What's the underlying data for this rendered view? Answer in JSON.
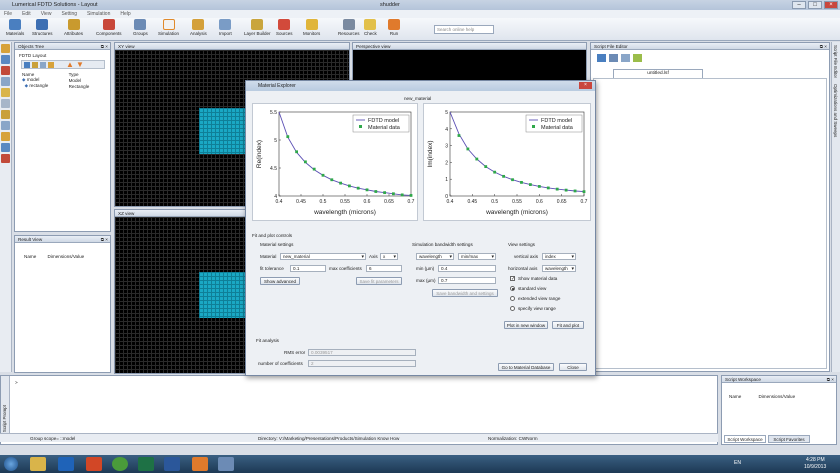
{
  "app": {
    "title": "Lumerical FDTD Solutions - Layout",
    "center_title": "shudder"
  },
  "menu": [
    "File",
    "Edit",
    "View",
    "Setting",
    "Simulation",
    "Help"
  ],
  "ribbon": [
    "Materials",
    "Structures",
    "Attributes",
    "Components",
    "Groups",
    "Simulation",
    "Analysis",
    "Import",
    "Layer Builder",
    "Sources",
    "Monitors",
    "Resources",
    "Check",
    "Run"
  ],
  "search_placeholder": "Search online help",
  "objects_tree": {
    "title": "Objects Tree",
    "root": "FDTD Layout",
    "columns": [
      "Name",
      "Type"
    ],
    "rows": [
      {
        "name": "model",
        "type": "Model"
      },
      {
        "name": "rectangle",
        "type": "Rectangle"
      }
    ]
  },
  "result_view": {
    "title": "Result View",
    "columns": [
      "Name",
      "Dimensions/Value"
    ]
  },
  "views": {
    "xy": "XY view",
    "xz": "XZ view",
    "persp": "Perspective view"
  },
  "script_editor": {
    "title": "Script File Editor",
    "tab": "untitled.lsf"
  },
  "right_tabs": [
    "Script File Editor",
    "Optimizations and Sweeps"
  ],
  "script_prompt": {
    "prompt_char": ">",
    "label": "Script Prompt"
  },
  "status": {
    "group": "Group scope= ::model",
    "directory": "Directory: V:/Marketing/Presentations/Products/Simulation Know How",
    "normalization": "Normalization: CWNorm"
  },
  "script_workspace": {
    "title": "Script Workspace",
    "columns": [
      "Name",
      "Dimensions/Value"
    ],
    "tabs": [
      "Script Workspace",
      "Script Favorites"
    ]
  },
  "clock": {
    "time": "4:28 PM",
    "date": "10/9/2013",
    "lang": "EN"
  },
  "dialog": {
    "title": "Material Explorer",
    "material_name": "new_material",
    "legend": [
      "FDTD model",
      "Material data"
    ],
    "section_fit": "Fit and plot controls",
    "material_settings": "Material settings",
    "material_label": "Material",
    "material_value": "new_material",
    "axis_label": "Axis",
    "axis_value": "x",
    "fit_tol_label": "fit tolerance",
    "fit_tol_value": "0.1",
    "max_coef_label": "max coefficients",
    "max_coef_value": "6",
    "show_advanced": "Show advanced",
    "save_fit": "Save fit parameters",
    "sim_bw": "Simulation bandwidth settings",
    "bw_unit": "wavelength",
    "bw_mode": "min/max",
    "min_label": "min (µm)",
    "min_value": "0.4",
    "max_label": "max (µm)",
    "max_value": "0.7",
    "save_bw": "Save bandwidth and settings",
    "view_settings": "View settings",
    "vaxis_label": "vertical axis",
    "vaxis_value": "index",
    "haxis_label": "horizontal axis",
    "haxis_value": "wavelength",
    "show_material": "Show material data",
    "radios": [
      "standard view",
      "extended view range",
      "specify view range"
    ],
    "plot_new": "Plot in new window",
    "fit_plot": "Fit and plot",
    "fit_analysis": "Fit analysis",
    "rms_label": "RMS error",
    "rms_value": "0.0039517",
    "ncoef_label": "number of coefficients",
    "ncoef_value": "2",
    "goto_db": "Go to Material Database",
    "close": "Close"
  },
  "chart_data": [
    {
      "type": "line",
      "xlabel": "wavelength (microns)",
      "ylabel": "Re(index)",
      "xlim": [
        0.4,
        0.7
      ],
      "ylim": [
        4,
        5.5
      ],
      "xticks": [
        "0.4",
        "0.45",
        "0.5",
        "0.55",
        "0.6",
        "0.65",
        "0.7"
      ],
      "yticks": [
        "4",
        "4.5",
        "5",
        "5.5"
      ],
      "series": [
        {
          "name": "FDTD model",
          "x": [
            0.4,
            0.42,
            0.44,
            0.46,
            0.48,
            0.5,
            0.52,
            0.54,
            0.56,
            0.58,
            0.6,
            0.62,
            0.64,
            0.66,
            0.68,
            0.7
          ],
          "y": [
            5.5,
            5.05,
            4.78,
            4.6,
            4.47,
            4.37,
            4.29,
            4.23,
            4.18,
            4.14,
            4.11,
            4.08,
            4.06,
            4.04,
            4.02,
            4.01
          ]
        },
        {
          "name": "Material data",
          "x": [
            0.42,
            0.44,
            0.46,
            0.48,
            0.5,
            0.52,
            0.54,
            0.56,
            0.58,
            0.6,
            0.62,
            0.64,
            0.66,
            0.68,
            0.7
          ],
          "y": [
            5.06,
            4.79,
            4.61,
            4.48,
            4.37,
            4.29,
            4.23,
            4.18,
            4.14,
            4.11,
            4.08,
            4.06,
            4.04,
            4.02,
            4.01
          ]
        }
      ]
    },
    {
      "type": "line",
      "xlabel": "wavelength (microns)",
      "ylabel": "Im(index)",
      "xlim": [
        0.4,
        0.7
      ],
      "ylim": [
        0,
        5
      ],
      "xticks": [
        "0.4",
        "0.45",
        "0.5",
        "0.55",
        "0.6",
        "0.65",
        "0.7"
      ],
      "yticks": [
        "0",
        "1",
        "2",
        "3",
        "4",
        "5"
      ],
      "series": [
        {
          "name": "FDTD model",
          "x": [
            0.4,
            0.42,
            0.44,
            0.46,
            0.48,
            0.5,
            0.52,
            0.54,
            0.56,
            0.58,
            0.6,
            0.62,
            0.64,
            0.66,
            0.68,
            0.7
          ],
          "y": [
            5,
            3.7,
            2.8,
            2.2,
            1.75,
            1.42,
            1.17,
            0.97,
            0.81,
            0.68,
            0.57,
            0.48,
            0.41,
            0.35,
            0.3,
            0.26
          ]
        },
        {
          "name": "Material data",
          "x": [
            0.42,
            0.44,
            0.46,
            0.48,
            0.5,
            0.52,
            0.54,
            0.56,
            0.58,
            0.6,
            0.62,
            0.64,
            0.66,
            0.68,
            0.7
          ],
          "y": [
            3.6,
            2.8,
            2.2,
            1.75,
            1.42,
            1.17,
            0.97,
            0.81,
            0.68,
            0.57,
            0.48,
            0.41,
            0.35,
            0.3,
            0.26
          ]
        }
      ]
    }
  ]
}
